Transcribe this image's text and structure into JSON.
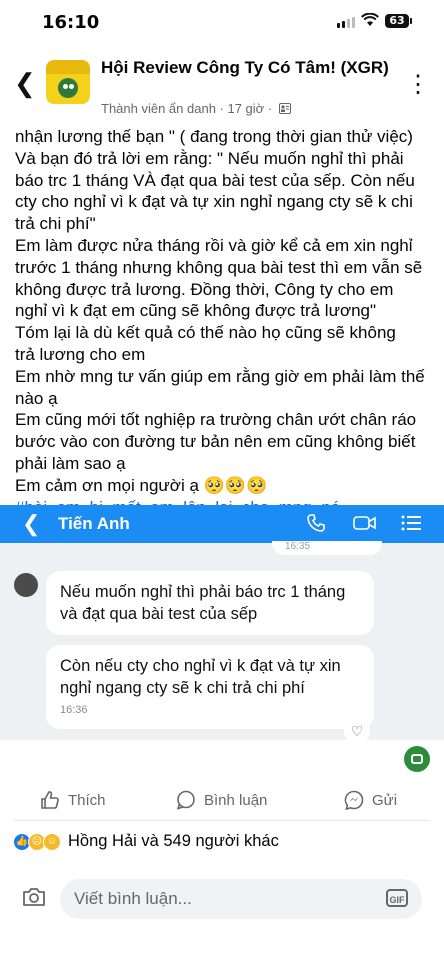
{
  "status_bar": {
    "time": "16:10",
    "battery": "63"
  },
  "header": {
    "group_name": "Hội Review Công Ty Có Tâm! (XGR)",
    "meta": "Thành viên ẩn danh · 17 giờ ·",
    "back_icon": "chevron-left-icon",
    "more_icon": "more-dots-icon"
  },
  "post": {
    "lines": [
      "nhận lương thế bạn \" ( đang trong thời gian thử việc)",
      "Và bạn đó trả lời em rằng: \" Nếu muốn nghỉ thì phải",
      "báo trc 1 tháng VÀ đạt qua bài test của sếp. Còn nếu",
      "cty cho nghỉ vì k đạt và tự xin nghỉ ngang cty sẽ k chi",
      "trả chi phí\"",
      "Em làm được nửa tháng rồi và giờ kể cả em xin nghỉ",
      "trước 1 tháng nhưng không qua bài test thì em vẫn sẽ",
      "không được trả lương. Đồng thời, Công ty cho em",
      "nghỉ vì k đạt em cũng sẽ không được trả lương\"",
      "Tóm lại là dù kết quả có thế nào họ cũng sẽ không",
      "trả lương cho em",
      "Em nhờ mng tư vấn giúp em rằng giờ em phải làm thế",
      "nào ạ",
      "Em cũng mới tốt nghiệp ra trường chân ướt chân ráo",
      "bước vào con đường tư bản nên em cũng không biết",
      "phải làm sao ạ",
      "Em cảm ơn mọi người ạ 🥺🥺🥺"
    ],
    "hashtag": "#bài_em_bị_mất_em_lên_lại_cho_mng_né"
  },
  "chat": {
    "contact_name": "Tiến Anh",
    "prev_time": "16:35",
    "message_1": "Nếu muốn nghỉ thì phải báo trc 1 tháng và đạt qua bài test của sếp",
    "message_2": "Còn nếu cty cho nghỉ vì k đạt và tự xin nghỉ ngang cty sẽ k chi trả chi phí",
    "message_2_time": "16:36"
  },
  "actions": {
    "like": "Thích",
    "comment": "Bình luận",
    "share": "Gửi"
  },
  "reactions": {
    "text": "Hồng Hải và 549 người khác"
  },
  "composer": {
    "placeholder": "Viết bình luận...",
    "gif_label": "GIF"
  },
  "colors": {
    "messenger_blue": "#1a8cf4",
    "hashtag_blue": "#1b66d2",
    "like_blue": "#1877f2"
  }
}
